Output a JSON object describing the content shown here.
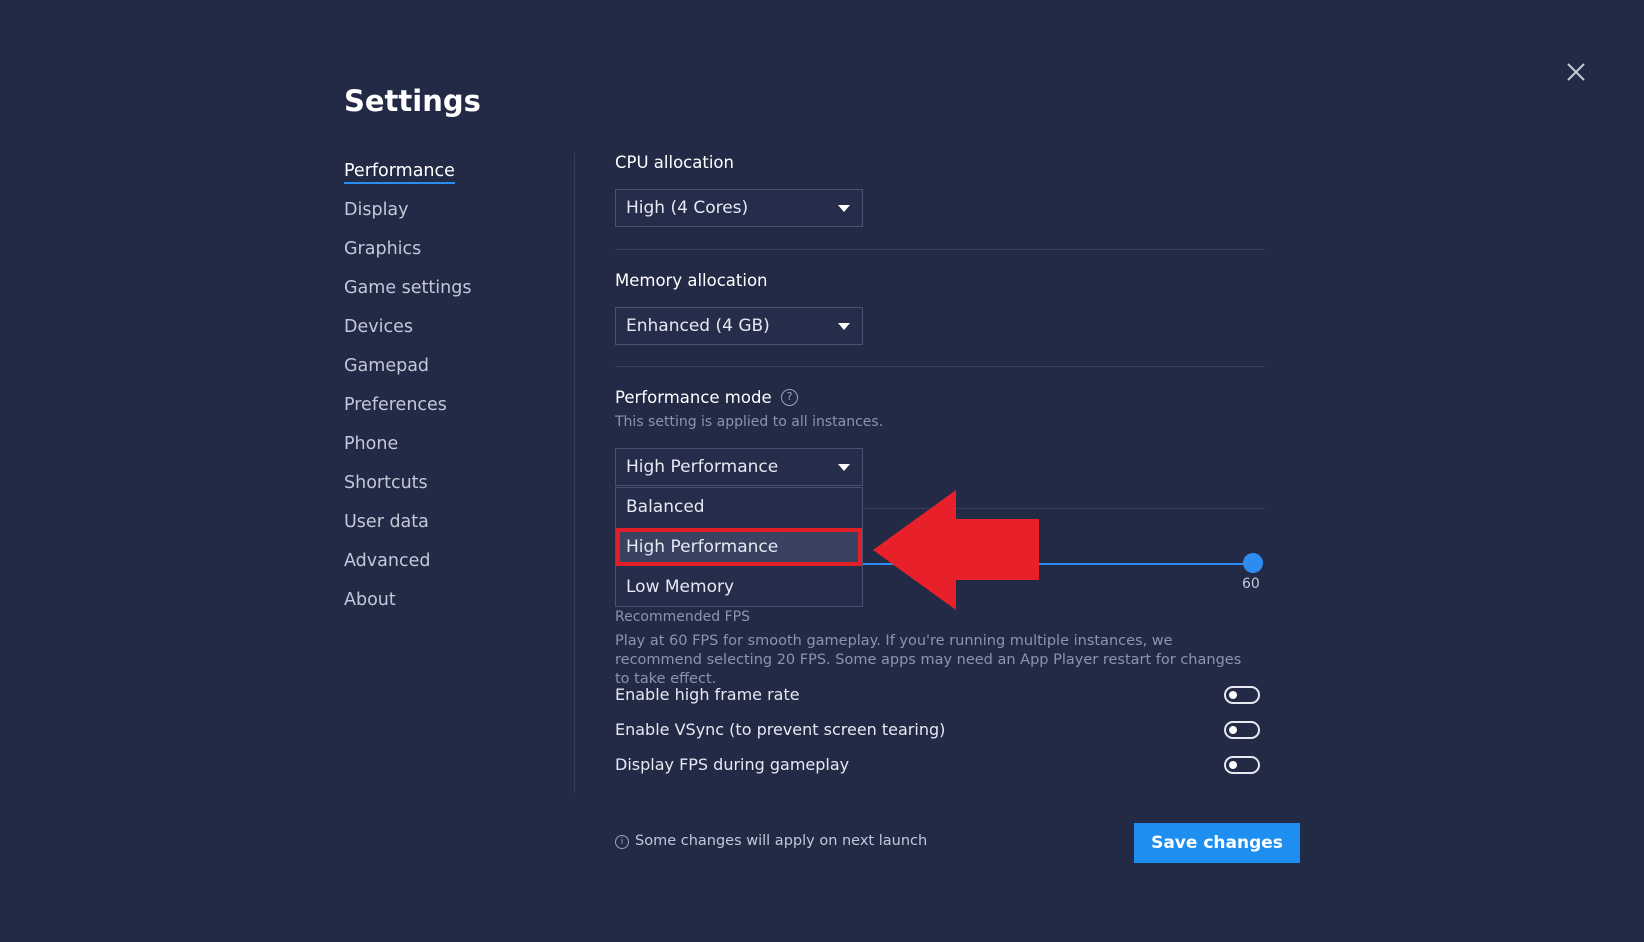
{
  "title": "Settings",
  "sidebar": {
    "items": [
      {
        "label": "Performance"
      },
      {
        "label": "Display"
      },
      {
        "label": "Graphics"
      },
      {
        "label": "Game settings"
      },
      {
        "label": "Devices"
      },
      {
        "label": "Gamepad"
      },
      {
        "label": "Preferences"
      },
      {
        "label": "Phone"
      },
      {
        "label": "Shortcuts"
      },
      {
        "label": "User data"
      },
      {
        "label": "Advanced"
      },
      {
        "label": "About"
      }
    ]
  },
  "cpu": {
    "label": "CPU allocation",
    "value": "High (4 Cores)"
  },
  "memory": {
    "label": "Memory allocation",
    "value": "Enhanced (4 GB)"
  },
  "perf_mode": {
    "label": "Performance mode",
    "help_icon": "?",
    "note": "This setting is applied to all instances.",
    "value": "High Performance",
    "options": [
      "Balanced",
      "High Performance",
      "Low Memory"
    ]
  },
  "fps": {
    "value": "60",
    "recommended_label": "Recommended FPS",
    "description": "Play at 60 FPS for smooth gameplay. If you're running multiple instances, we recommend selecting 20 FPS. Some apps may need an App Player restart for changes to take effect."
  },
  "toggles": [
    {
      "label": "Enable high frame rate"
    },
    {
      "label": "Enable VSync (to prevent screen tearing)"
    },
    {
      "label": "Display FPS during gameplay"
    }
  ],
  "footer": {
    "info_icon": "i",
    "note": "Some changes will apply on next launch",
    "save_label": "Save changes"
  },
  "colors": {
    "background": "#232a45",
    "accent": "#1e8ef0",
    "highlight_arrow": "#e8202a"
  }
}
